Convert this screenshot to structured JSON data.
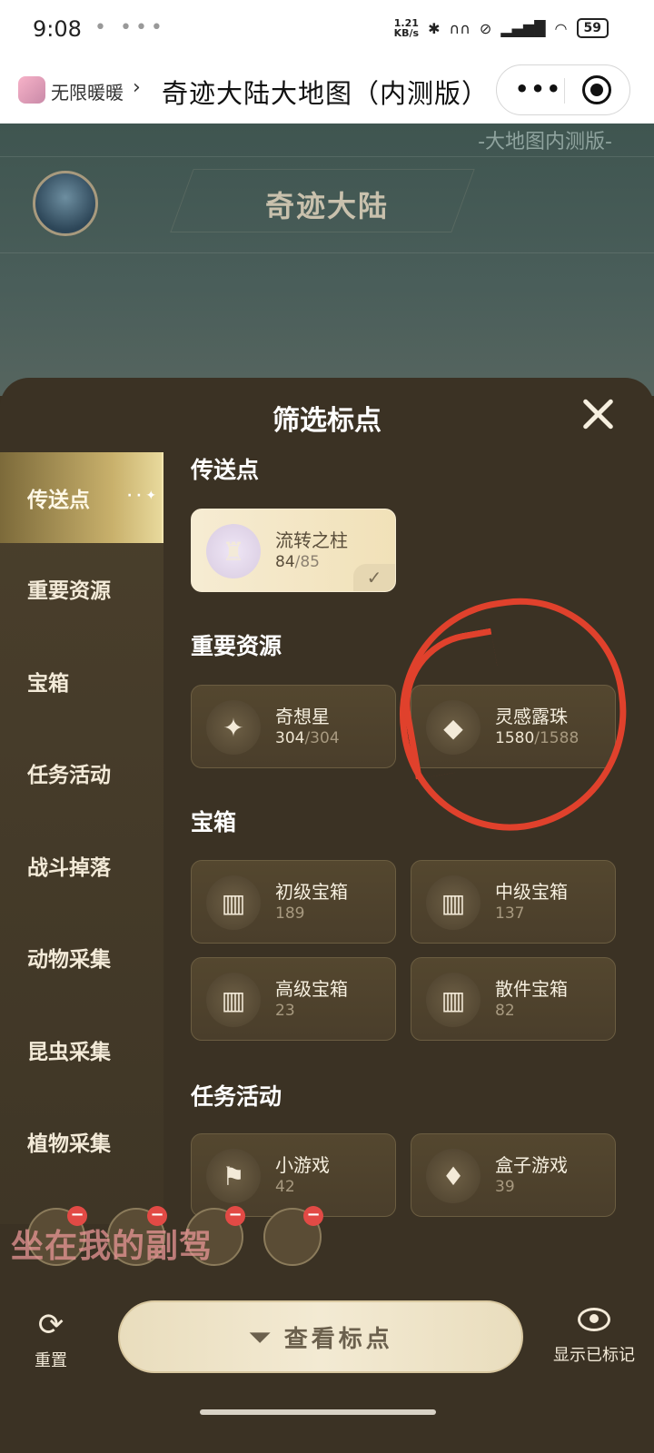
{
  "status_bar": {
    "time": "9:08",
    "speed": "1.21",
    "speed_unit": "KB/s",
    "battery": "59"
  },
  "app_bar": {
    "app_name": "无限暖暖",
    "chevron": "›",
    "page_title": "奇迹大陆大地图（内测版）",
    "more_icon": "•••"
  },
  "map": {
    "version_tag": "-大地图内测版-",
    "region_name": "奇迹大陆"
  },
  "sheet": {
    "title": "筛选标点"
  },
  "sidebar": {
    "items": [
      {
        "label": "传送点",
        "active": true
      },
      {
        "label": "重要资源"
      },
      {
        "label": "宝箱"
      },
      {
        "label": "任务活动"
      },
      {
        "label": "战斗掉落"
      },
      {
        "label": "动物采集"
      },
      {
        "label": "昆虫采集"
      },
      {
        "label": "植物采集"
      }
    ]
  },
  "sections": {
    "teleport": {
      "title": "传送点",
      "cards": [
        {
          "name": "流转之柱",
          "found": "84",
          "total": "/85",
          "icon": "pillar-icon",
          "selected": true
        }
      ]
    },
    "resources": {
      "title": "重要资源",
      "cards": [
        {
          "name": "奇想星",
          "found": "304",
          "total": "/304",
          "icon": "star-icon"
        },
        {
          "name": "灵感露珠",
          "found": "1580",
          "total": "/1588",
          "icon": "dewdrop-icon"
        }
      ]
    },
    "chests": {
      "title": "宝箱",
      "cards": [
        {
          "name": "初级宝箱",
          "count": "189",
          "icon": "chest-icon"
        },
        {
          "name": "中级宝箱",
          "count": "137",
          "icon": "chest-icon"
        },
        {
          "name": "高级宝箱",
          "count": "23",
          "icon": "chest-icon"
        },
        {
          "name": "散件宝箱",
          "count": "82",
          "icon": "chest-icon"
        }
      ]
    },
    "tasks": {
      "title": "任务活动",
      "cards": [
        {
          "name": "小游戏",
          "count": "42",
          "icon": "flag-icon"
        },
        {
          "name": "盒子游戏",
          "count": "39",
          "icon": "cards-icon"
        }
      ]
    }
  },
  "chips_minus": "−",
  "watermark": "坐在我的副驾",
  "bottom": {
    "reset_label": "重置",
    "view_label": "查看标点",
    "show_marked_label": "显示已标记"
  },
  "colors": {
    "accent_gold": "#c9b16c",
    "annotation_red": "#e0412c",
    "background": "#3b3224"
  }
}
